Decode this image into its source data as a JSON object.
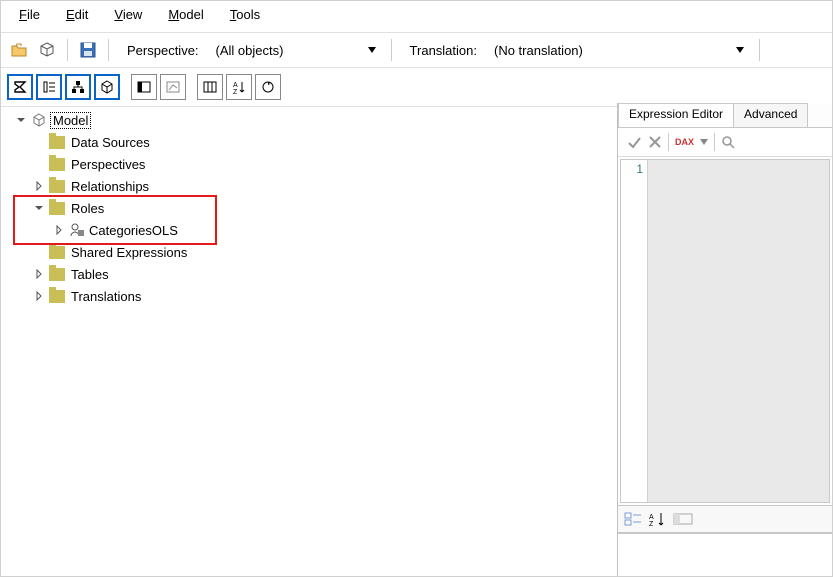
{
  "menu": {
    "file": "File",
    "edit": "Edit",
    "view": "View",
    "model": "Model",
    "tools": "Tools"
  },
  "perspective": {
    "label": "Perspective:",
    "value": "(All objects)"
  },
  "translation": {
    "label": "Translation:",
    "value": "(No translation)"
  },
  "tree": {
    "root": "Model",
    "data_sources": "Data Sources",
    "perspectives": "Perspectives",
    "relationships": "Relationships",
    "roles": "Roles",
    "categories_ols": "CategoriesOLS",
    "shared_expressions": "Shared Expressions",
    "tables": "Tables",
    "translations": "Translations"
  },
  "right": {
    "tab_editor": "Expression Editor",
    "tab_advanced": "Advanced",
    "dax_label": "DAX",
    "line_no": "1"
  }
}
